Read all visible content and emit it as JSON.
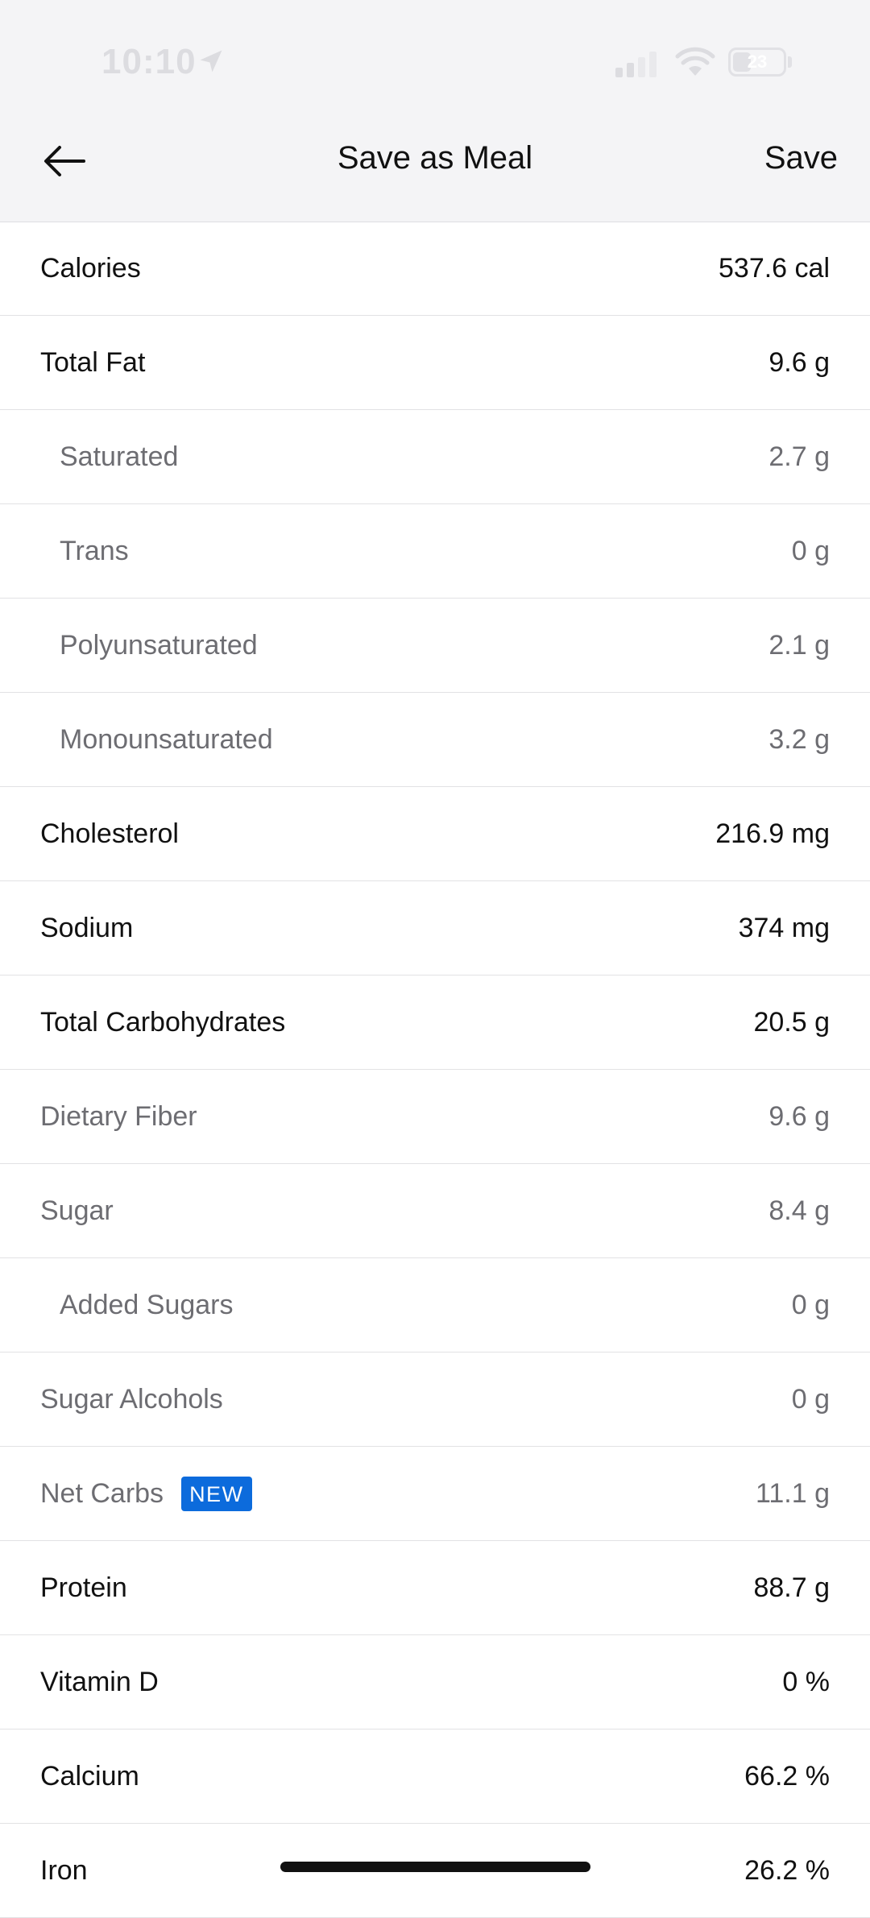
{
  "status_bar": {
    "time": "10:10",
    "battery": "23"
  },
  "header": {
    "title": "Save as Meal",
    "save_label": "Save"
  },
  "nutrients": [
    {
      "label": "Calories",
      "value": "537.6 cal",
      "style": "primary",
      "indent": false
    },
    {
      "label": "Total Fat",
      "value": "9.6 g",
      "style": "primary",
      "indent": false
    },
    {
      "label": "Saturated",
      "value": "2.7 g",
      "style": "secondary",
      "indent": true
    },
    {
      "label": "Trans",
      "value": "0 g",
      "style": "secondary",
      "indent": true
    },
    {
      "label": "Polyunsaturated",
      "value": "2.1 g",
      "style": "secondary",
      "indent": true
    },
    {
      "label": "Monounsaturated",
      "value": "3.2 g",
      "style": "secondary",
      "indent": true
    },
    {
      "label": "Cholesterol",
      "value": "216.9 mg",
      "style": "primary",
      "indent": false
    },
    {
      "label": "Sodium",
      "value": "374 mg",
      "style": "primary",
      "indent": false
    },
    {
      "label": "Total Carbohydrates",
      "value": "20.5 g",
      "style": "primary",
      "indent": false
    },
    {
      "label": "Dietary Fiber",
      "value": "9.6 g",
      "style": "secondary",
      "indent": false
    },
    {
      "label": "Sugar",
      "value": "8.4 g",
      "style": "secondary",
      "indent": false
    },
    {
      "label": "Added Sugars",
      "value": "0 g",
      "style": "secondary",
      "indent": true
    },
    {
      "label": "Sugar Alcohols",
      "value": "0 g",
      "style": "secondary",
      "indent": false
    },
    {
      "label": "Net Carbs",
      "value": "11.1 g",
      "style": "secondary",
      "indent": false,
      "badge": "NEW"
    },
    {
      "label": "Protein",
      "value": "88.7 g",
      "style": "primary",
      "indent": false
    },
    {
      "label": "Vitamin D",
      "value": "0 %",
      "style": "primary",
      "indent": false
    },
    {
      "label": "Calcium",
      "value": "66.2 %",
      "style": "primary",
      "indent": false
    },
    {
      "label": "Iron",
      "value": "26.2 %",
      "style": "primary",
      "indent": false
    }
  ],
  "colors": {
    "header_bg": "#f4f4f6",
    "badge_bg": "#0c6bdc",
    "secondary_text": "#6d6d72"
  }
}
